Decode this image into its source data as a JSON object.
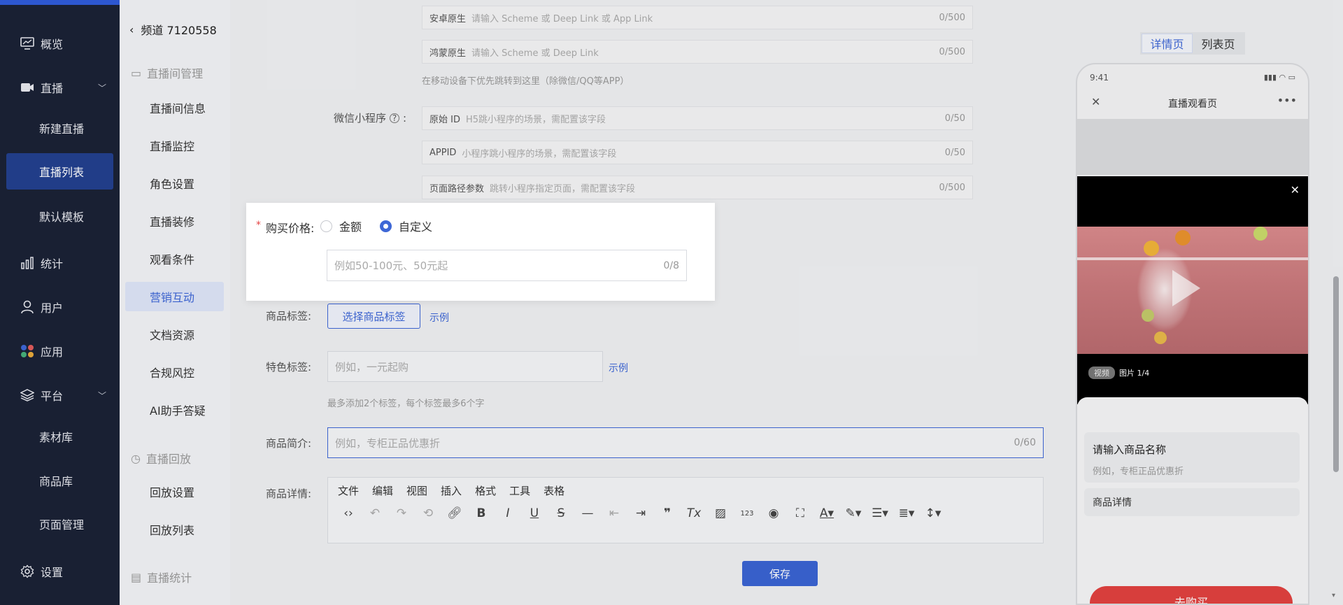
{
  "nav": {
    "items": [
      {
        "label": "概览",
        "icon": "monitor-icon"
      },
      {
        "label": "直播",
        "icon": "video-camera-icon",
        "expanded": true
      },
      {
        "label": "统计",
        "icon": "bar-chart-icon"
      },
      {
        "label": "用户",
        "icon": "user-icon"
      },
      {
        "label": "应用",
        "icon": "apps-icon"
      },
      {
        "label": "平台",
        "icon": "layers-icon",
        "expanded": true
      },
      {
        "label": "设置",
        "icon": "gear-icon"
      }
    ],
    "live_sub": [
      "新建直播",
      "直播列表",
      "默认模板"
    ],
    "platform_sub": [
      "素材库",
      "商品库",
      "页面管理"
    ],
    "active_sub": "直播列表"
  },
  "channel": {
    "title": "频道 7120558",
    "group_room": "直播间管理",
    "room_items": [
      "直播间信息",
      "直播监控",
      "角色设置",
      "直播装修",
      "观看条件",
      "营销互动",
      "文档资源",
      "合规风控",
      "AI助手答疑"
    ],
    "active_item": "营销互动",
    "group_replay": "直播回放",
    "replay_items": [
      "回放设置",
      "回放列表"
    ],
    "group_stats": "直播统计"
  },
  "form": {
    "android": {
      "prefix": "安卓原生",
      "placeholder": "请输入 Scheme 或 Deep Link 或 App Link",
      "count": "0/500"
    },
    "harmony": {
      "prefix": "鸿蒙原生",
      "placeholder": "请输入 Scheme 或 Deep Link",
      "count": "0/500"
    },
    "mobile_hint": "在移动设备下优先跳转到这里（除微信/QQ等APP）",
    "miniprogram_label": "微信小程序",
    "colon": ":",
    "orig_id": {
      "prefix": "原始 ID",
      "placeholder": "H5跳小程序的场景，需配置该字段",
      "count": "0/50"
    },
    "appid": {
      "prefix": "APPID",
      "placeholder": "小程序跳小程序的场景，需配置该字段",
      "count": "0/50"
    },
    "path": {
      "prefix": "页面路径参数",
      "placeholder": "跳转小程序指定页面，需配置该字段",
      "count": "0/500"
    },
    "tag_label": "商品标签:",
    "tag_button": "选择商品标签",
    "example": "示例",
    "feature_label": "特色标签:",
    "feature_placeholder": "例如，一元起购",
    "feature_hint": "最多添加2个标签，每个标签最多6个字",
    "intro_label": "商品简介:",
    "intro_placeholder": "例如，专柜正品优惠折",
    "intro_count": "0/60",
    "detail_label": "商品详情:",
    "editor_menu": [
      "文件",
      "编辑",
      "视图",
      "插入",
      "格式",
      "工具",
      "表格"
    ],
    "save": "保存"
  },
  "popup": {
    "required": "*",
    "label": "购买价格:",
    "option_amount": "金额",
    "option_custom": "自定义",
    "selected": "自定义",
    "placeholder": "例如50-100元、50元起",
    "count": "0/8"
  },
  "preview": {
    "tab_detail": "详情页",
    "tab_list": "列表页",
    "active_tab": "详情页",
    "time": "9:41",
    "title": "直播观看页",
    "media_pill": "视频",
    "media_counter": "图片 1/4",
    "product_name": "请输入商品名称",
    "product_desc": "例如，专柜正品优惠折",
    "detail_peek": "商品详情",
    "buy": "去购买"
  },
  "colors": {
    "accent": "#3e67d6",
    "nav_bg": "#1b2236",
    "buy": "#e0413f"
  }
}
